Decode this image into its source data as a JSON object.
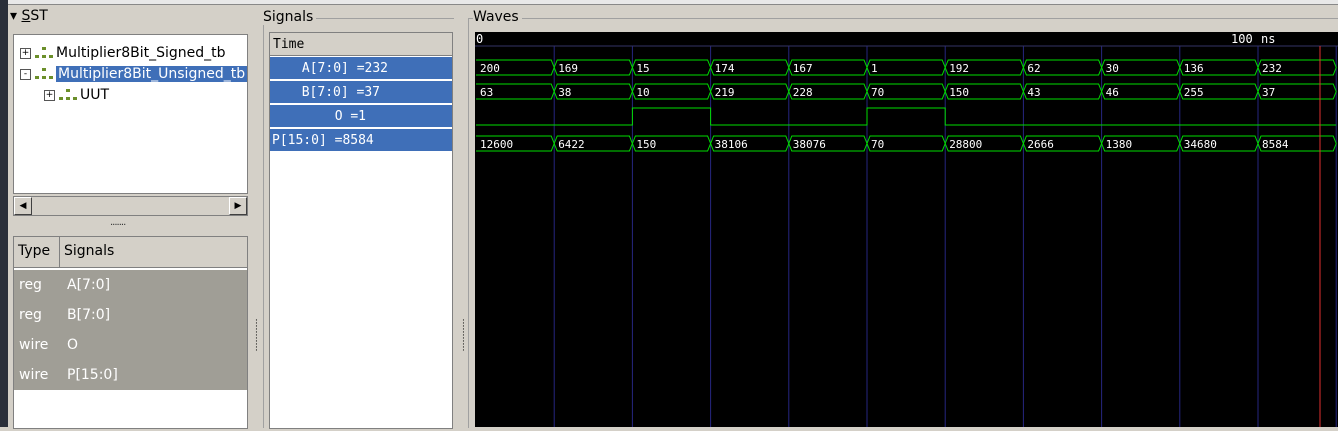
{
  "sst": {
    "title_prefix": "▾ ",
    "title_underlined": "S",
    "title_rest": "ST",
    "tree": [
      {
        "expander": "+",
        "label": "Multiplier8Bit_Signed_tb",
        "selected": false
      },
      {
        "expander": "-",
        "label": "Multiplier8Bit_Unsigned_tb",
        "selected": true
      },
      {
        "expander": "+",
        "label": "UUT",
        "selected": false
      }
    ],
    "scroll_left": "◀",
    "scroll_right": "▶",
    "grip": "·······",
    "columns": {
      "type": "Type",
      "signals": "Signals"
    },
    "signal_rows": [
      {
        "type": "reg",
        "name": "A[7:0]"
      },
      {
        "type": "reg",
        "name": "B[7:0]"
      },
      {
        "type": "wire",
        "name": "O"
      },
      {
        "type": "wire",
        "name": "P[15:0]"
      }
    ]
  },
  "signals_panel": {
    "title": "Signals",
    "header": "Time",
    "rows": [
      {
        "label": "A[7:0] =232"
      },
      {
        "label": "B[7:0] =37"
      },
      {
        "label": "O =1"
      },
      {
        "label": "P[15:0] =8584"
      }
    ]
  },
  "waves_panel": {
    "title": "Waves",
    "time_start": "0",
    "time_marker": "100",
    "time_unit": "ns",
    "colors": {
      "trace": "#00dc00",
      "background": "#000000",
      "grid": "#262680",
      "cursor": "#e03030"
    },
    "bus_A": [
      "200",
      "169",
      "15",
      "174",
      "167",
      "1",
      "192",
      "62",
      "30",
      "136",
      "232"
    ],
    "bus_B": [
      "63",
      "38",
      "10",
      "219",
      "228",
      "70",
      "150",
      "43",
      "46",
      "255",
      "37"
    ],
    "bit_O": [
      0,
      0,
      1,
      0,
      0,
      1,
      0,
      0,
      0,
      0,
      0
    ],
    "bus_P": [
      "12600",
      "6422",
      "150",
      "38106",
      "38076",
      "70",
      "28800",
      "2666",
      "1380",
      "34680",
      "8584"
    ]
  }
}
